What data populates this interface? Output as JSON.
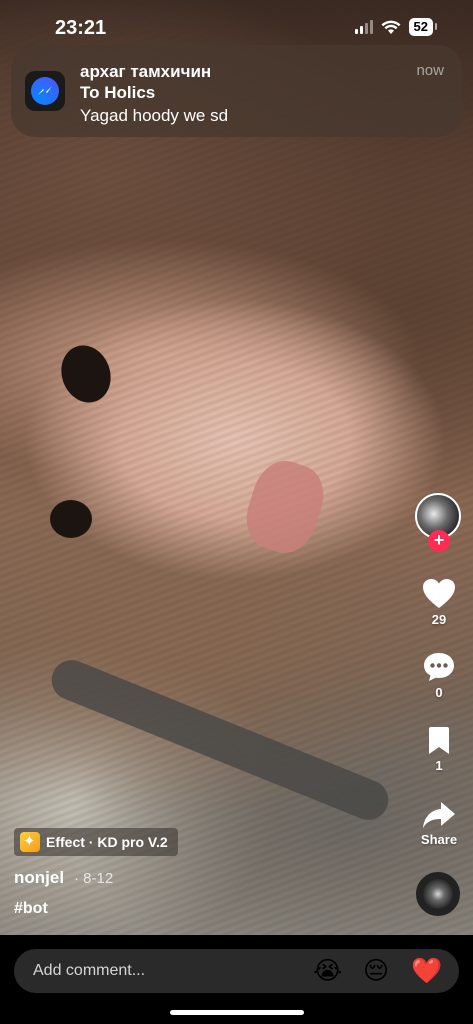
{
  "status_bar": {
    "time": "23:21",
    "battery": "52"
  },
  "notification": {
    "app_icon": "messenger-icon",
    "sender": "архаг тамхичин",
    "group": "To Holics",
    "message": "Yagad hoody we sd",
    "time": "now"
  },
  "actions": {
    "follow_icon": "plus-icon",
    "likes": "29",
    "comments": "0",
    "bookmarks": "1",
    "share_label": "Share"
  },
  "post": {
    "effect_label": "Effect · KD pro V.2",
    "author": "nonjel",
    "date": "· 8-12",
    "hashtag": "#bot"
  },
  "comment_bar": {
    "placeholder": "Add comment...",
    "emojis": [
      "😭",
      "😔",
      "❤️"
    ]
  },
  "colors": {
    "follow_red": "#fe2c55",
    "like_red": "#e0245e"
  }
}
